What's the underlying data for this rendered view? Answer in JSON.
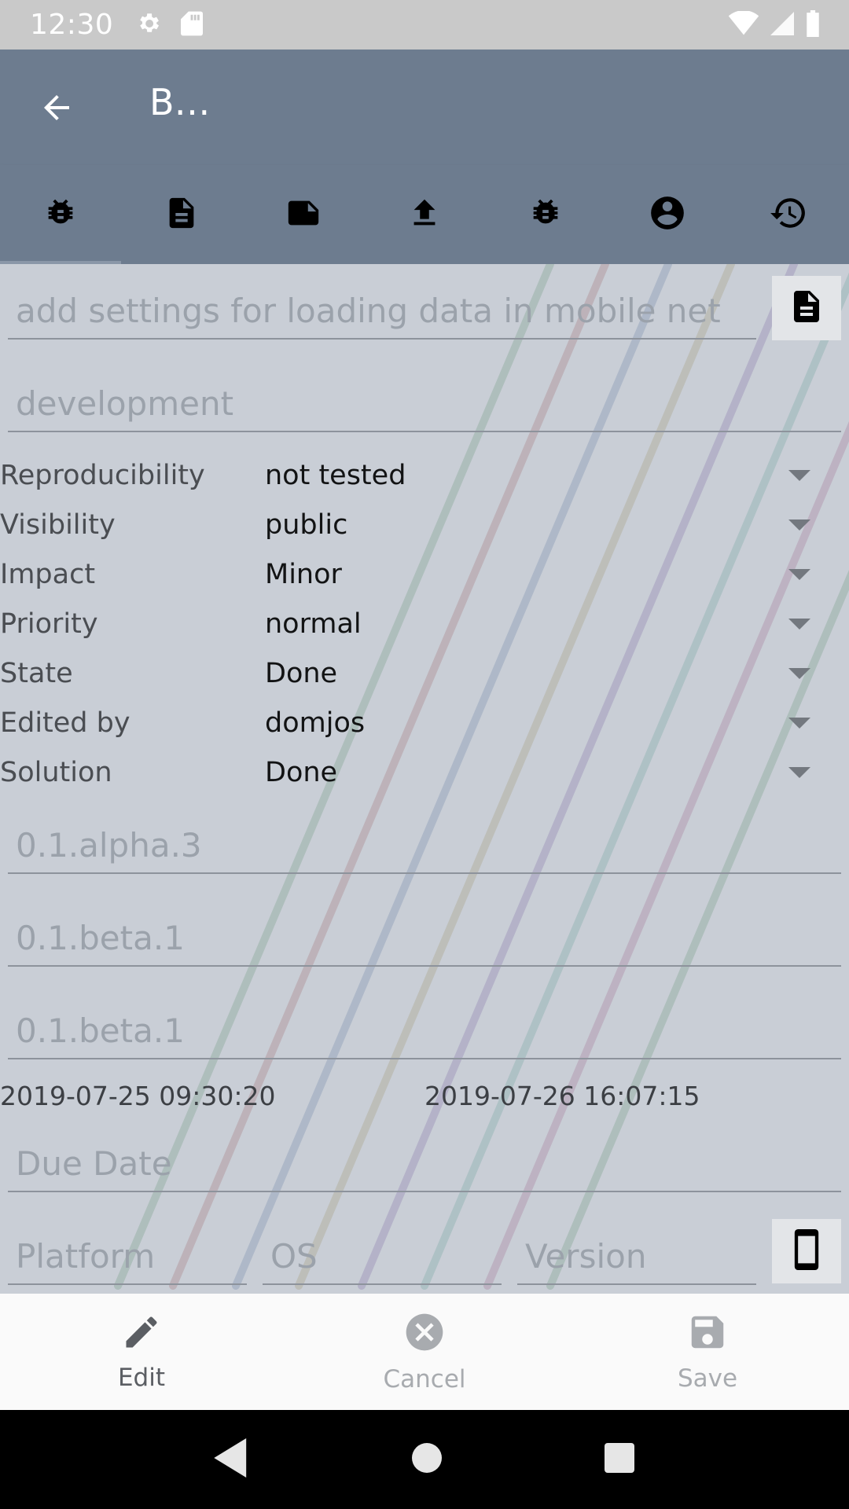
{
  "status_bar": {
    "time": "12:30",
    "icons": [
      "settings-icon",
      "sd-card-icon",
      "wifi-icon",
      "signal-icon",
      "battery-icon"
    ]
  },
  "app_bar": {
    "title": "B…",
    "back_icon": "arrow-back-icon"
  },
  "tabs": [
    {
      "name": "bug-icon"
    },
    {
      "name": "description-icon"
    },
    {
      "name": "note-icon"
    },
    {
      "name": "upload-icon"
    },
    {
      "name": "bug-icon"
    },
    {
      "name": "account-circle-icon"
    },
    {
      "name": "history-icon"
    }
  ],
  "form": {
    "summary_placeholder": "add settings for loading data in mobile net",
    "category_placeholder": "development",
    "properties": [
      {
        "label": "Reproducibility",
        "value": "not tested"
      },
      {
        "label": "Visibility",
        "value": "public"
      },
      {
        "label": "Impact",
        "value": "Minor"
      },
      {
        "label": "Priority",
        "value": "normal"
      },
      {
        "label": "State",
        "value": "Done"
      },
      {
        "label": "Edited by",
        "value": "domjos"
      },
      {
        "label": "Solution",
        "value": "Done"
      }
    ],
    "version_detected": "0.1.alpha.3",
    "version_target": "0.1.beta.1",
    "version_fixed": "0.1.beta.1",
    "created": "2019-07-25 09:30:20",
    "updated": "2019-07-26 16:07:15",
    "due_date_placeholder": "Due Date",
    "platform_placeholder": "Platform",
    "os_placeholder": "OS",
    "version_placeholder": "Version"
  },
  "actions": {
    "edit_label": "Edit",
    "cancel_label": "Cancel",
    "save_label": "Save"
  },
  "colors": {
    "app_bar": "#6d7c8f",
    "content_bg": "#c9ced6",
    "action_active": "#5b5e63",
    "action_disabled": "#a8abaf"
  }
}
